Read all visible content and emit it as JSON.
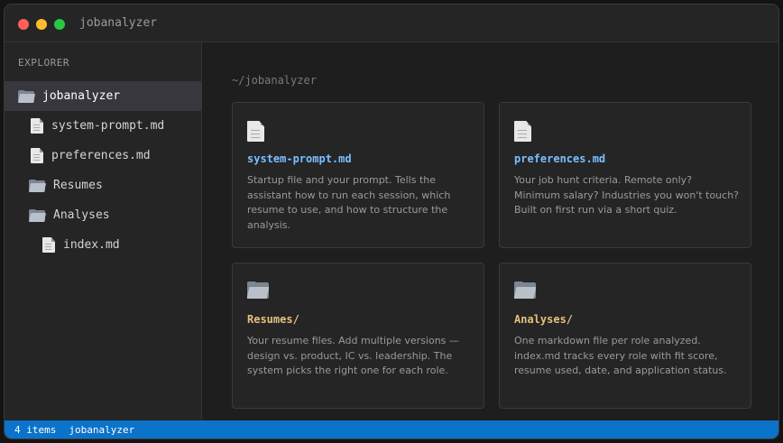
{
  "window": {
    "title": "jobanalyzer"
  },
  "sidebar": {
    "header": "EXPLORER",
    "items": [
      {
        "label": "jobanalyzer",
        "type": "folder",
        "active": true
      },
      {
        "label": "system-prompt.md",
        "type": "file"
      },
      {
        "label": "preferences.md",
        "type": "file"
      },
      {
        "label": "Resumes",
        "type": "folder"
      },
      {
        "label": "Analyses",
        "type": "folder"
      },
      {
        "label": "index.md",
        "type": "file"
      }
    ]
  },
  "main": {
    "path": "~/jobanalyzer",
    "cards": [
      {
        "title": "system-prompt.md",
        "type": "file",
        "icon": "file-icon",
        "description": "Startup file and your prompt. Tells the assistant how to run each session, which resume to use, and how to structure the analysis."
      },
      {
        "title": "preferences.md",
        "type": "file",
        "icon": "file-icon",
        "description": "Your job hunt criteria. Remote only? Minimum salary? Industries you won't touch? Built on first run via a short quiz."
      },
      {
        "title": "Resumes/",
        "type": "folder",
        "icon": "folder-icon",
        "description": "Your resume files. Add multiple versions — design vs. product, IC vs. leadership. The system picks the right one for each role."
      },
      {
        "title": "Analyses/",
        "type": "folder",
        "icon": "folder-icon",
        "description": "One markdown file per role analyzed. index.md tracks every role with fit score, resume used, date, and application status."
      }
    ]
  },
  "statusbar": {
    "count": "4 items",
    "project": "jobanalyzer"
  },
  "colors": {
    "file_title": "#79c0ff",
    "folder_title": "#e5c07b",
    "statusbar": "#0b73c9",
    "traffic_red": "#ff5f57",
    "traffic_yellow": "#febc2e",
    "traffic_green": "#28c840"
  }
}
